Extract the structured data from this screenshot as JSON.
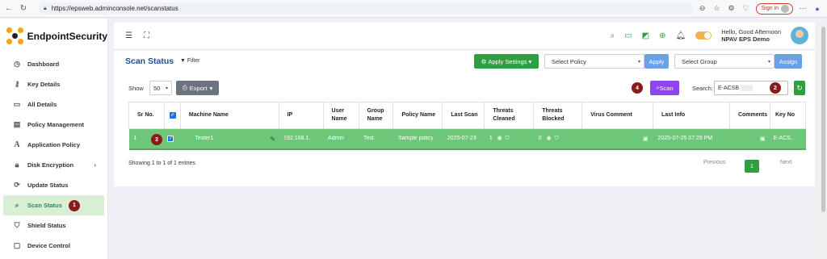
{
  "browser": {
    "url": "https://epsweb.adminconsole.net/scanstatus",
    "sign_in": "Sign in"
  },
  "sidebar": {
    "brand": "EndpointSecurity",
    "items": [
      {
        "label": "Dashboard",
        "icon": "clock-icon"
      },
      {
        "label": "Key Details",
        "icon": "key-icon"
      },
      {
        "label": "All Details",
        "icon": "monitor-icon"
      },
      {
        "label": "Policy Management",
        "icon": "document-icon"
      },
      {
        "label": "Application Policy",
        "icon": "font-a-icon"
      },
      {
        "label": "Disk Encryption",
        "icon": "lock-icon"
      },
      {
        "label": "Update Status",
        "icon": "refresh-icon"
      },
      {
        "label": "Scan Status",
        "icon": "search-icon"
      },
      {
        "label": "Shield Status",
        "icon": "shield-icon"
      },
      {
        "label": "Device Control",
        "icon": "device-icon"
      }
    ]
  },
  "header": {
    "greeting": "Hello, Good Afternoon",
    "user": "NPAV EPS Demo"
  },
  "main": {
    "title": "Scan Status",
    "filter": "Filter",
    "apply_settings": "Apply Settings",
    "select_policy": "Select Policy",
    "apply": "Apply",
    "select_group": "Select Group",
    "assign": "Assign",
    "show": "Show",
    "show_value": "50",
    "export": "Export",
    "scan": "Scan",
    "search_label": "Search:",
    "search_value": "E-ACSB",
    "columns": [
      "Sr No.",
      "",
      "Machine Name",
      "IP",
      "User Name",
      "Group Name",
      "Policy Name",
      "Last Scan",
      "Threats Cleaned",
      "Threats Blocked",
      "Virus Comment",
      "Last Info",
      "Comments",
      "Key No"
    ],
    "row": {
      "sr": "1",
      "machine": "Tester1",
      "ip": "192.168.1.",
      "user": "Admin",
      "group": "Test",
      "policy": "Sample policy",
      "last_scan": "2025-07-23",
      "threats_cleaned": "1",
      "threats_blocked": "0",
      "last_info": "2025-07-25 07:29 PM",
      "key_no": "E-ACS.."
    },
    "entries": "Showing 1 to 1 of 1 entries",
    "previous": "Previous",
    "page": "1",
    "next": "Next"
  },
  "badges": [
    "1",
    "2",
    "3",
    "4"
  ],
  "colors": {
    "accent_green": "#2e9e40",
    "title_blue": "#1f4f8a",
    "row_green": "#6ec779",
    "scan_purple": "#8e44ef",
    "badge": "#8b1a1a"
  }
}
